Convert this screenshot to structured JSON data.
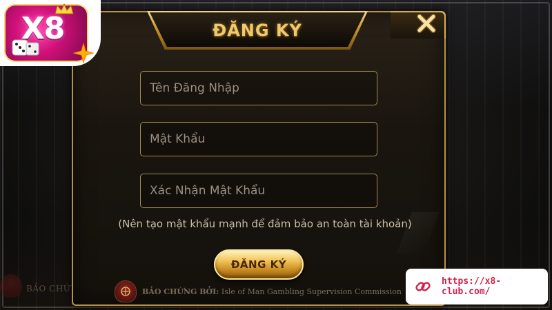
{
  "logo": {
    "text": "X8"
  },
  "dialog": {
    "title": "ĐĂNG KÝ",
    "fields": {
      "username_placeholder": "Tên Đăng Nhập",
      "password_placeholder": "Mật Khẩu",
      "confirm_placeholder": "Xác Nhận Mật Khẩu"
    },
    "hint": "(Nên tạo mật khẩu mạnh để đảm bảo an toàn tài khoản)",
    "submit_label": "ĐĂNG KÝ"
  },
  "license": {
    "label": "BẢO CHỨNG BỞI:",
    "authority": "Isle of Man Gambling Supervision Commission"
  },
  "background": {
    "left_text": "BẢO CHỨ"
  },
  "url_badge": {
    "url": "https://x8-club.com/"
  },
  "colors": {
    "gold": "#f0c96a",
    "frame": "#b8924a",
    "link_red": "#d2204a"
  },
  "icons": {
    "close": "close-icon",
    "link": "link-icon",
    "seal": "seal-icon"
  }
}
